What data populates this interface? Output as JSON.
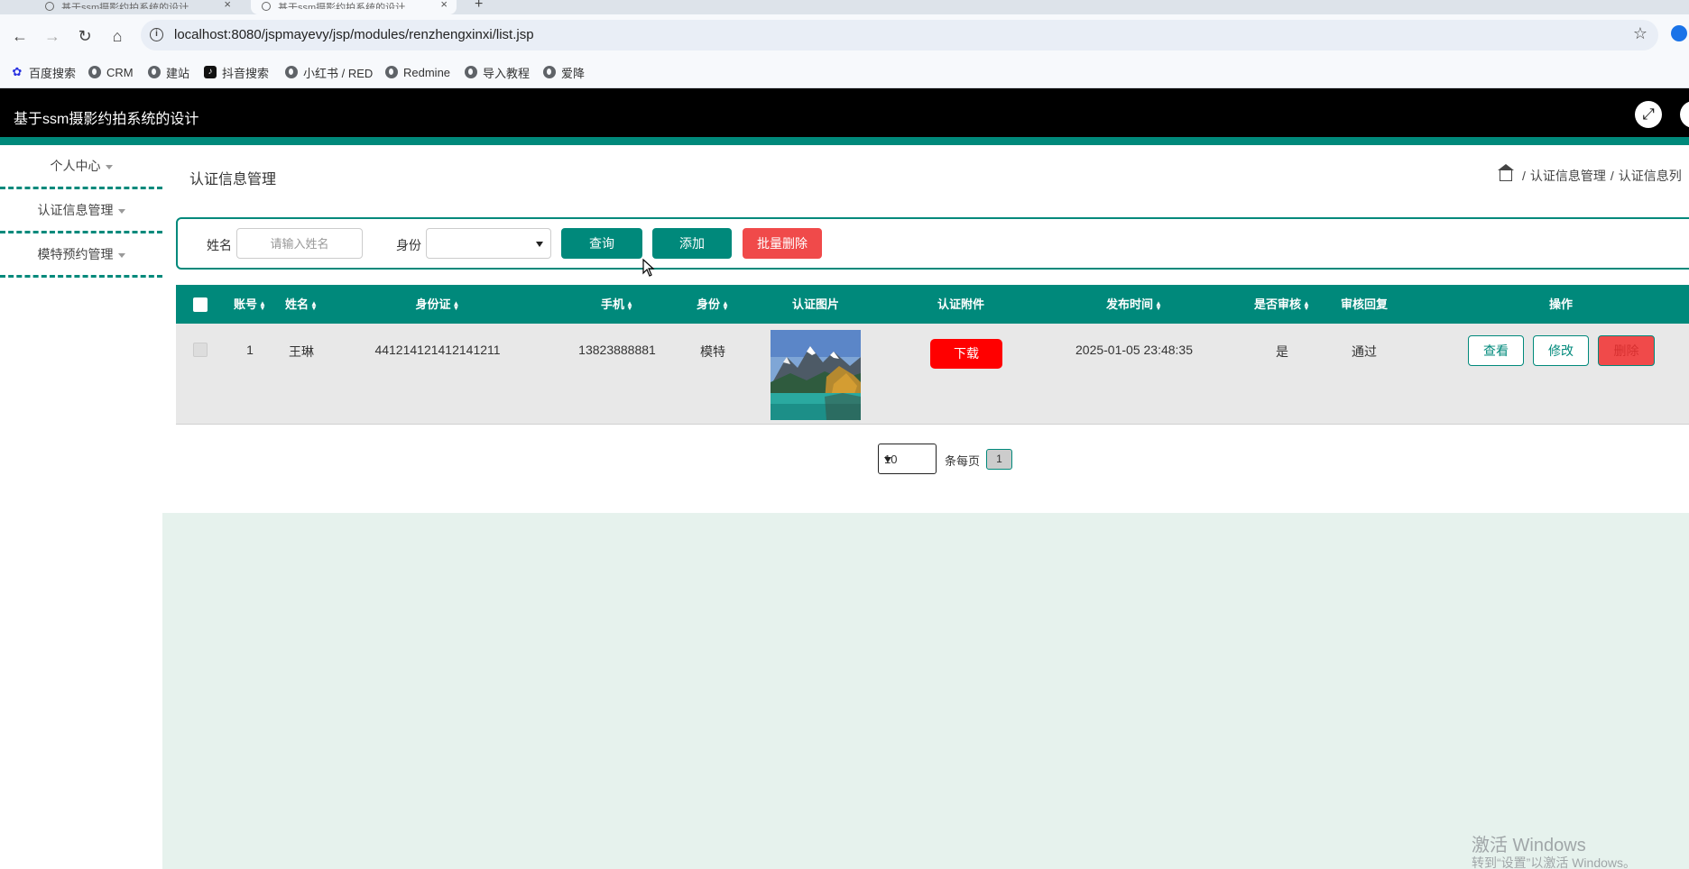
{
  "browser": {
    "tabs": [
      {
        "title": "基于ssm摄影约拍系统的设计"
      },
      {
        "title": "基于ssm摄影约拍系统的设计"
      }
    ],
    "url": "localhost:8080/jspmayevy/jsp/modules/renzhengxinxi/list.jsp",
    "bookmarks": [
      "百度搜索",
      "CRM",
      "建站",
      "抖音搜索",
      "小红书 / RED",
      "Redmine",
      "导入教程",
      "爱降"
    ]
  },
  "app": {
    "title": "基于ssm摄影约拍系统的设计"
  },
  "sidebar": {
    "items": [
      {
        "label": "个人中心"
      },
      {
        "label": "认证信息管理"
      },
      {
        "label": "模特预约管理"
      }
    ]
  },
  "page": {
    "title": "认证信息管理",
    "breadcrumb": [
      "认证信息管理",
      "认证信息列"
    ]
  },
  "search": {
    "name_label": "姓名",
    "name_placeholder": "请输入姓名",
    "name_value": "",
    "identity_label": "身份",
    "identity_value": "",
    "query_button": "查询",
    "add_button": "添加",
    "batch_delete_button": "批量删除"
  },
  "table": {
    "headers": {
      "account": "账号",
      "name": "姓名",
      "id_card": "身份证",
      "phone": "手机",
      "identity": "身份",
      "cert_image": "认证图片",
      "cert_attachment": "认证附件",
      "publish_time": "发布时间",
      "reviewed": "是否审核",
      "review_reply": "审核回复",
      "actions": "操作"
    },
    "rows": [
      {
        "account": "1",
        "name": "王琳",
        "id_card": "441214121412141211",
        "phone": "13823888881",
        "identity": "模特",
        "download_label": "下载",
        "publish_time": "2025-01-05 23:48:35",
        "reviewed": "是",
        "review_reply": "通过",
        "view_label": "查看",
        "edit_label": "修改",
        "delete_label": "删除"
      }
    ]
  },
  "pagination": {
    "page_size": "10",
    "per_page_label": "条每页",
    "current_page": "1"
  },
  "watermark": {
    "line1": "激活 Windows",
    "line2": "转到“设置”以激活 Windows。"
  },
  "colors": {
    "accent": "#00897b",
    "danger": "#f04a4a",
    "download": "#ff0000",
    "header_bg": "#000000",
    "content_bg": "#e6f2ed"
  }
}
